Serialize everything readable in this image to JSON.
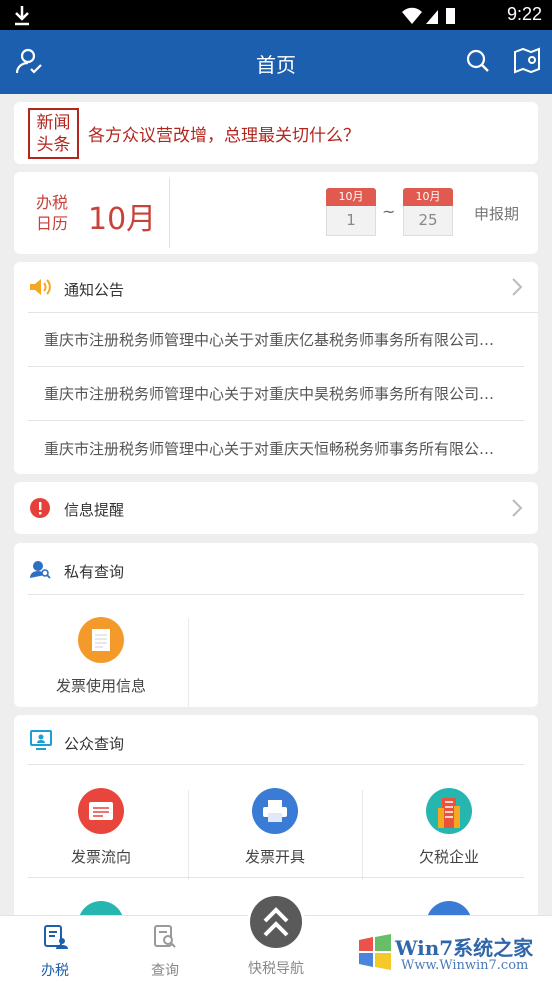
{
  "status_bar": {
    "time": "9:22"
  },
  "app_bar": {
    "title": "首页"
  },
  "news": {
    "badge_line1": "新闻",
    "badge_line2": "头条",
    "headline": "各方众议营改增，总理最关切什么？"
  },
  "calendar": {
    "label_line1": "办税",
    "label_line2": "日历",
    "month": "10月",
    "start": {
      "month": "10月",
      "day": "1"
    },
    "separator": "~",
    "end": {
      "month": "10月",
      "day": "25"
    },
    "period_label": "申报期"
  },
  "notice": {
    "title": "通知公告",
    "items": [
      "重庆市注册税务师管理中心关于对重庆亿基税务师事务所有限公司…",
      "重庆市注册税务师管理中心关于对重庆中昊税务师事务所有限公司…",
      "重庆市注册税务师管理中心关于对重庆天恒畅税务师事务所有限公…"
    ]
  },
  "info_reminder": {
    "title": "信息提醒"
  },
  "private_query": {
    "title": "私有查询",
    "items": [
      {
        "label": "发票使用信息",
        "icon": "invoice-doc-icon",
        "color": "#f39a2b"
      }
    ]
  },
  "public_query": {
    "title": "公众查询",
    "items": [
      {
        "label": "发票流向",
        "icon": "invoice-flow-icon",
        "color": "#e8453c"
      },
      {
        "label": "发票开具",
        "icon": "printer-icon",
        "color": "#3a7bd5"
      },
      {
        "label": "欠税企业",
        "icon": "building-icon",
        "color": "#27b5b0"
      }
    ]
  },
  "bottom_nav": [
    {
      "label": "办税",
      "icon": "tax-service-icon",
      "active": true
    },
    {
      "label": "查询",
      "icon": "query-icon",
      "active": false
    },
    {
      "label": "快税导航",
      "icon": "quick-nav-icon",
      "active": false
    }
  ],
  "watermark": {
    "line1": "Win7系统之家",
    "line2": "Www.Winwin7.com"
  },
  "colors": {
    "primary": "#1c5fae",
    "accent_red": "#c8423a",
    "active_tab": "#1c5fae"
  }
}
